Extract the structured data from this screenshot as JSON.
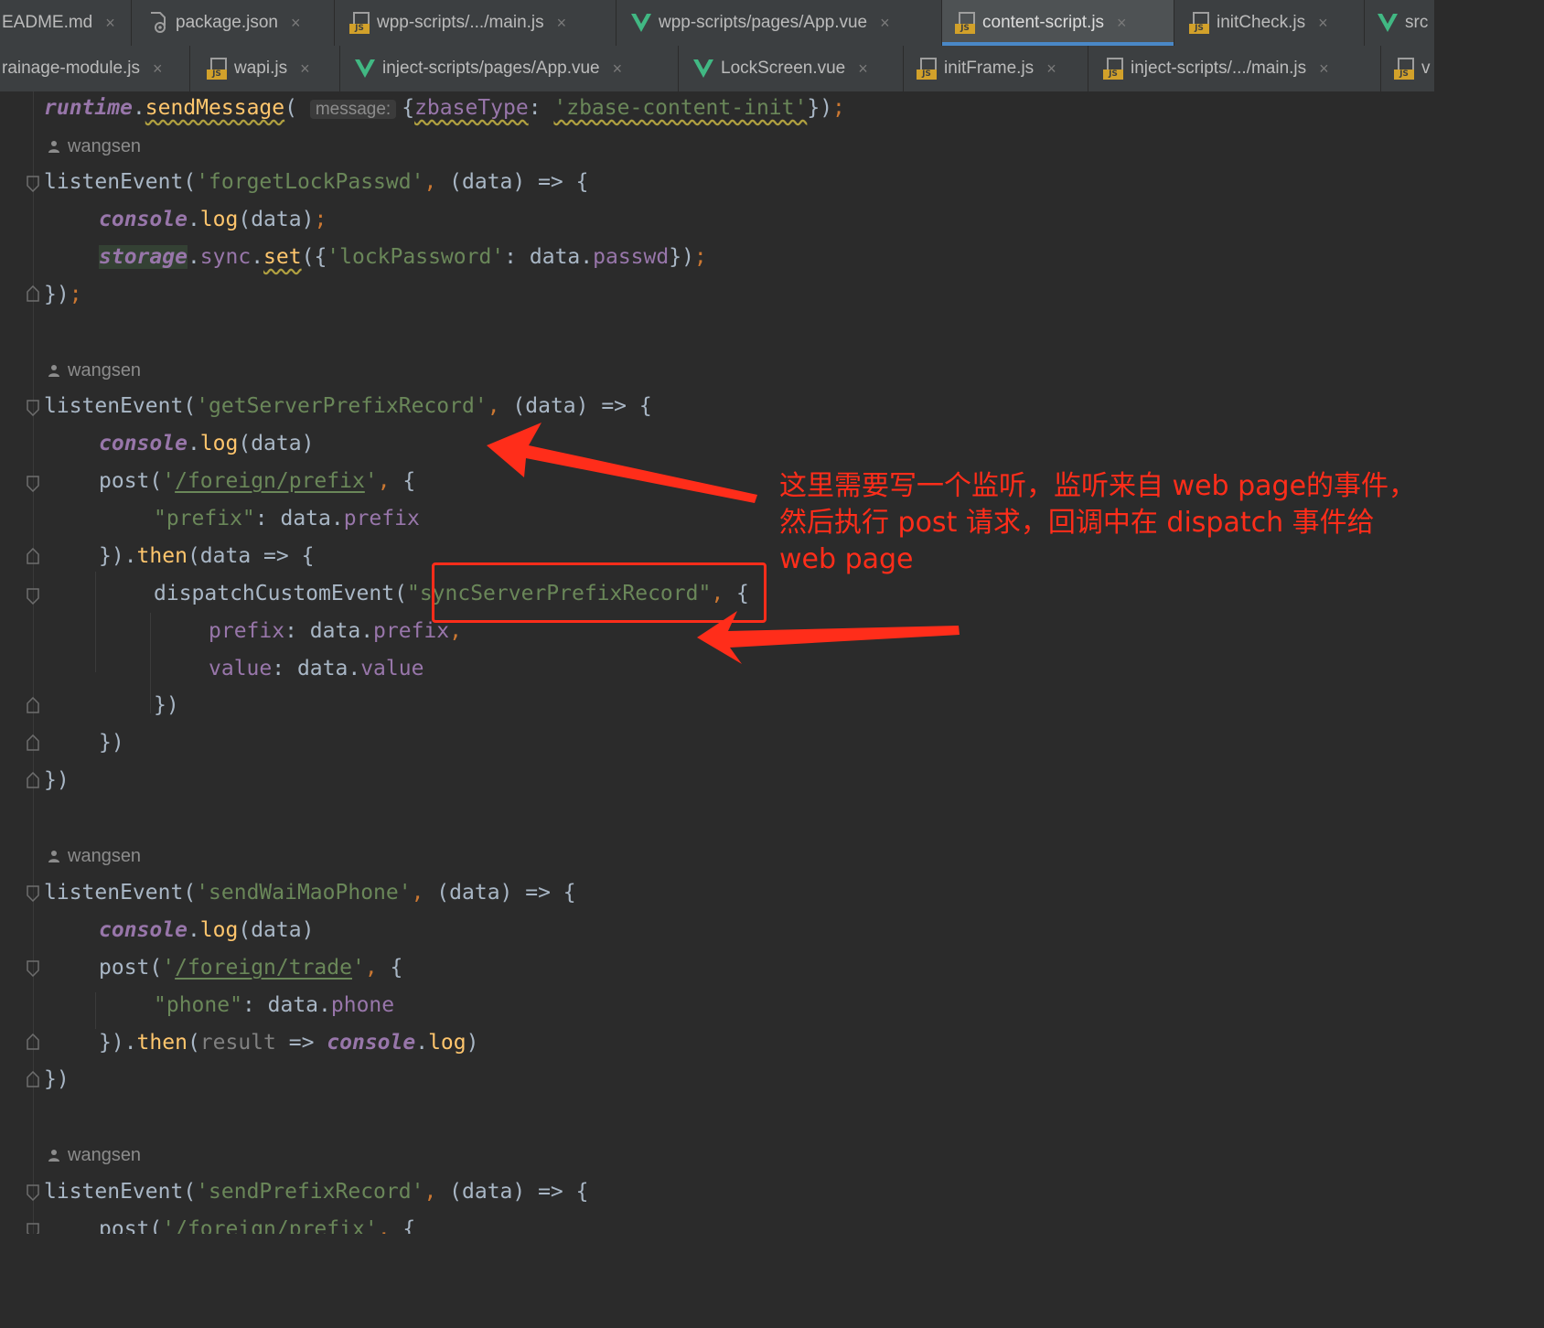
{
  "tabs_row1": [
    {
      "label": "EADME.md",
      "icon": "markdown-file-icon",
      "active": false
    },
    {
      "label": "package.json",
      "icon": "json-file-icon",
      "active": false
    },
    {
      "label": "wpp-scripts/.../main.js",
      "icon": "js-file-icon",
      "active": false
    },
    {
      "label": "wpp-scripts/pages/App.vue",
      "icon": "vue-file-icon",
      "active": false
    },
    {
      "label": "content-script.js",
      "icon": "js-file-icon",
      "active": true
    },
    {
      "label": "initCheck.js",
      "icon": "js-file-icon",
      "active": false
    },
    {
      "label": "src",
      "icon": "vue-file-icon",
      "active": false
    }
  ],
  "tabs_row2": [
    {
      "label": "rainage-module.js",
      "icon": "js-file-icon"
    },
    {
      "label": "wapi.js",
      "icon": "js-file-icon"
    },
    {
      "label": "inject-scripts/pages/App.vue",
      "icon": "vue-file-icon"
    },
    {
      "label": "LockScreen.vue",
      "icon": "vue-file-icon"
    },
    {
      "label": "initFrame.js",
      "icon": "js-file-icon"
    },
    {
      "label": "inject-scripts/.../main.js",
      "icon": "js-file-icon"
    },
    {
      "label": "v",
      "icon": "js-file-icon"
    }
  ],
  "tab_close_glyph": "×",
  "tab_js_badge": "JS",
  "inlay_hint": "message:",
  "author": "wangsen",
  "code": {
    "runtime": "runtime",
    "sendMessage": "sendMessage",
    "zbaseType": "zbaseType",
    "zbase_init_str": "'zbase-content-init'",
    "listenEvent": "listenEvent",
    "ev_forget": "'forgetLockPasswd'",
    "ev_getPrefix": "'getServerPrefixRecord'",
    "ev_sendPhone": "'sendWaiMaoPhone'",
    "ev_sendPrefix": "'sendPrefixRecord'",
    "data": "data",
    "console": "console",
    "log": "log",
    "storage": "storage",
    "sync": "sync",
    "set": "set",
    "lockPassword_str": "'lockPassword'",
    "passwd": "passwd",
    "post": "post",
    "url_prefix": "/foreign/prefix",
    "url_trade": "/foreign/trade",
    "prefix_key_str": "\"prefix\"",
    "phone_key_str": "\"phone\"",
    "prefix": "prefix",
    "phone": "phone",
    "then": "then",
    "result": "result",
    "dispatchCustomEvent": "dispatchCustomEvent",
    "sync_event_str": "\"syncServerPrefixRecord\"",
    "value": "value"
  },
  "annotation": {
    "text": "这里需要写一个监听，监听来自 web page的事件，然后执行 post 请求，回调中在 dispatch 事件给 web page",
    "color": "#ff2d1a"
  },
  "colors": {
    "background": "#2b2b2b",
    "keyword": "#cc7832",
    "string": "#6a8759",
    "function": "#ffc66d",
    "property": "#9876aa",
    "text": "#a9b7c6",
    "active_tab_underline": "#4a88c7"
  }
}
